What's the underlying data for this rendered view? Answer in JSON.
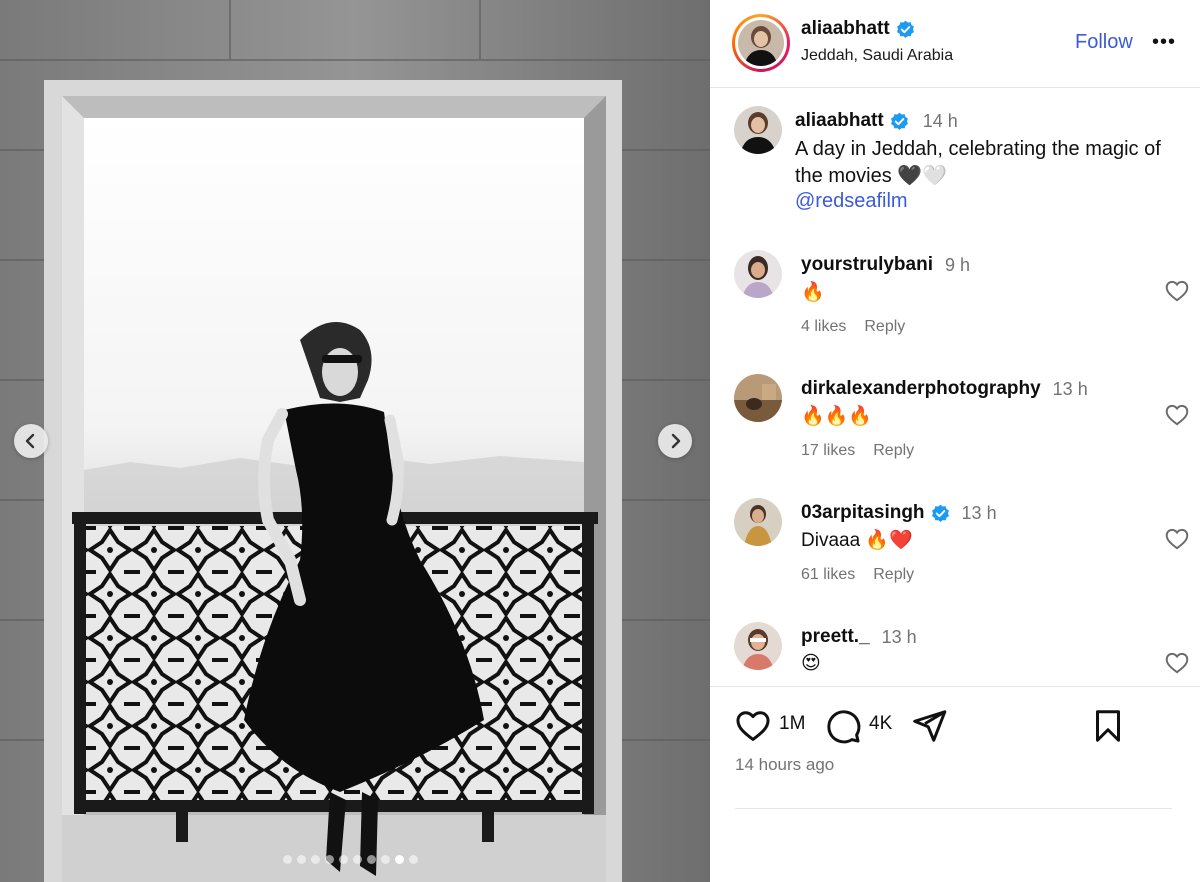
{
  "post": {
    "username": "aliaabhatt",
    "verified": true,
    "location": "Jeddah, Saudi Arabia",
    "follow_label": "Follow",
    "more_label": "•••"
  },
  "caption": {
    "username": "aliaabhatt",
    "time": "14 h",
    "text": "A day in Jeddah, celebrating the magic of the movies 🖤🤍",
    "mention": "@redseafilm"
  },
  "comments": [
    {
      "username": "yourstrulybani",
      "verified": false,
      "time": "9 h",
      "text": "🔥",
      "likes": "4 likes",
      "reply": "Reply"
    },
    {
      "username": "dirkalexanderphotography",
      "verified": false,
      "time": "13 h",
      "text": "🔥🔥🔥",
      "likes": "17 likes",
      "reply": "Reply"
    },
    {
      "username": "03arpitasingh",
      "verified": true,
      "time": "13 h",
      "text": "Divaaa 🔥❤️",
      "likes": "61 likes",
      "reply": "Reply"
    },
    {
      "username": "preett._",
      "verified": false,
      "time": "13 h",
      "text": "😍",
      "likes": "",
      "reply": ""
    }
  ],
  "actions": {
    "like_count": "1M",
    "comment_count": "4K",
    "posted_time": "14 hours ago"
  },
  "carousel": {
    "total": 10,
    "active_index": 8
  },
  "colors": {
    "link": "#3b5bd9",
    "verified": "#1d9bf0",
    "muted": "#737373"
  },
  "icons": {
    "verified": "verified-badge-icon",
    "like": "heart-icon",
    "comment": "comment-icon",
    "share": "share-icon",
    "save": "bookmark-icon",
    "prev": "chevron-left-icon",
    "next": "chevron-right-icon"
  }
}
